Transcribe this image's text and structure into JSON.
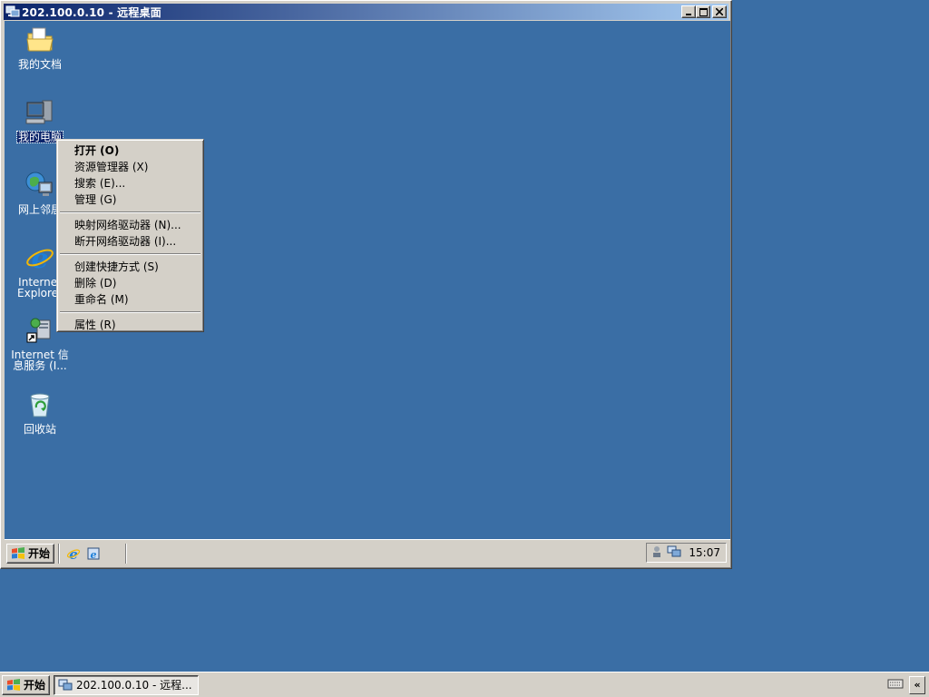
{
  "remote_window": {
    "title": "202.100.0.10 - 远程桌面",
    "minimize_glyph": "_",
    "maximize_glyph": "□",
    "close_glyph": "✕"
  },
  "desktop_icons": [
    {
      "id": "my-documents",
      "label": "我的文档",
      "icon": "folder-documents-icon"
    },
    {
      "id": "my-computer",
      "label": "我的电脑",
      "icon": "computer-icon",
      "selected": true
    },
    {
      "id": "network-places",
      "label": "网上邻居",
      "icon": "network-icon"
    },
    {
      "id": "internet-explorer",
      "label": "Internet\nExplorer",
      "icon": "ie-icon"
    },
    {
      "id": "iis",
      "label": "Internet 信\n息服务 (I...",
      "icon": "iis-shortcut-icon"
    },
    {
      "id": "recycle-bin",
      "label": "回收站",
      "icon": "recycle-bin-icon"
    }
  ],
  "context_menu": {
    "open": "打开 (O)",
    "explorer": "资源管理器 (X)",
    "search": "搜索 (E)...",
    "manage": "管理 (G)",
    "map_drive": "映射网络驱动器 (N)...",
    "disconnect_drive": "断开网络驱动器 (I)...",
    "create_shortcut": "创建快捷方式 (S)",
    "delete": "删除 (D)",
    "rename": "重命名 (M)",
    "properties": "属性 (R)"
  },
  "remote_taskbar": {
    "start_label": "开始",
    "clock": "15:07"
  },
  "host_taskbar": {
    "start_label": "开始",
    "task_label": "202.100.0.10 - 远程...",
    "chevron": "«"
  },
  "colors": {
    "desktop": "#3a6ea5",
    "title_active_start": "#0a246a",
    "title_active_end": "#a6caf0",
    "face": "#d4d0c8"
  }
}
